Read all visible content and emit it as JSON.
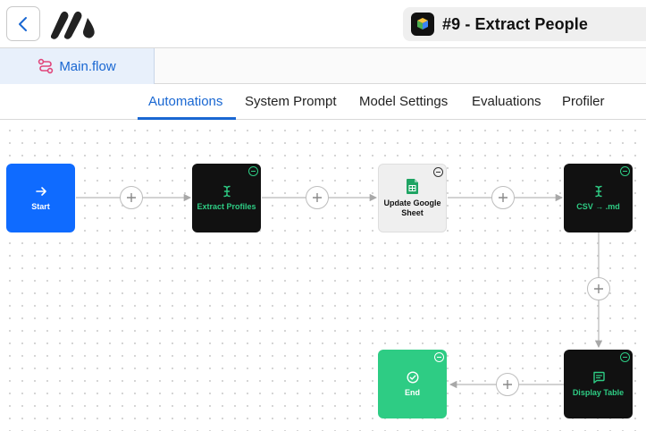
{
  "header": {
    "back_icon": "chevron-left-icon",
    "logo_icon": "brand-logo",
    "project_icon": "cube-icon",
    "project_title": "#9 - Extract People"
  },
  "file_tab": {
    "icon": "flow-icon",
    "label": "Main.flow"
  },
  "nav": {
    "tabs": [
      {
        "label": "Automations",
        "active": true
      },
      {
        "label": "System Prompt",
        "active": false
      },
      {
        "label": "Model Settings",
        "active": false
      },
      {
        "label": "Evaluations",
        "active": false
      },
      {
        "label": "Profiler",
        "active": false
      }
    ]
  },
  "flow": {
    "nodes": [
      {
        "label": "Start",
        "icon": "arrow-right-icon",
        "style": "blue"
      },
      {
        "label": "Extract Profiles",
        "icon": "text-cursor-icon",
        "style": "dark"
      },
      {
        "label": "Update Google Sheet",
        "icon": "google-sheets-icon",
        "style": "light"
      },
      {
        "label": "CSV → .md",
        "icon": "text-cursor-icon",
        "style": "dark"
      },
      {
        "label": "Display Table",
        "icon": "message-square-icon",
        "style": "dark"
      },
      {
        "label": "End",
        "icon": "check-circle-icon",
        "style": "green"
      }
    ],
    "add_icon": "plus-icon",
    "remove_icon": "minus-circle-icon"
  },
  "colors": {
    "accent": "#1967d2",
    "node_blue": "#0f6bff",
    "node_dark": "#111111",
    "node_green": "#2ecc84"
  }
}
